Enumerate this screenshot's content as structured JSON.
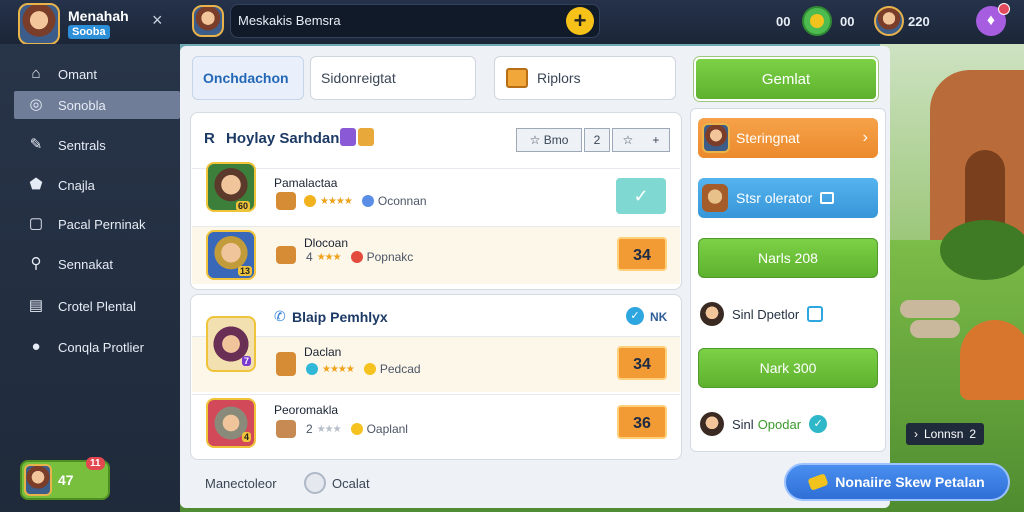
{
  "header": {
    "app_title": "Menahah",
    "app_badge": "Sooba",
    "close_glyph": "×",
    "search_text": "Meskakis Bemsra",
    "plus_glyph": "+",
    "stat_left": "00",
    "stat_mid": "00",
    "stat_right": "220"
  },
  "sidebar": {
    "items": [
      {
        "label": "Omant",
        "icon": "home-icon",
        "glyph": "⌂"
      },
      {
        "label": "Sonobla",
        "icon": "camera-icon",
        "glyph": "◎"
      },
      {
        "label": "Sentrals",
        "icon": "leaf-icon",
        "glyph": "✎"
      },
      {
        "label": "Cnajla",
        "icon": "house-icon",
        "glyph": "⬟"
      },
      {
        "label": "Pacal Perninak",
        "icon": "page-icon",
        "glyph": "▢"
      },
      {
        "label": "Sennakat",
        "icon": "search-icon",
        "glyph": "⚲"
      },
      {
        "label": "Crotel Plental",
        "icon": "doc-icon",
        "glyph": "▤"
      },
      {
        "label": "Conqla Protlier",
        "icon": "location-pin-icon",
        "glyph": "●"
      }
    ],
    "level_value": "47",
    "level_badge": "11"
  },
  "tabs": {
    "tab1": "Onchdachon",
    "tab2": "Sidonreigtat",
    "tab3": "Riplors",
    "action": "Gemlat"
  },
  "card1": {
    "prefix": "R",
    "title": "Hoylay Sarhdan",
    "tool_label": "Bmo",
    "tool_num": "2",
    "rows": [
      {
        "name": "Pamalactaa",
        "stars": "★★★★",
        "meta": "Oconnan",
        "tag": "60"
      },
      {
        "name": "Dlocoan",
        "stars": "★★★",
        "rank": "4",
        "meta": "Popnakc",
        "value": "34",
        "tag": "13"
      }
    ]
  },
  "card2": {
    "title": "Blaip Pemhlyx",
    "right_label": "NK",
    "rows": [
      {
        "name": "Daclan",
        "stars": "★★★★",
        "meta": "Pedcad",
        "value": "34",
        "tag": "7"
      },
      {
        "name": "Peoromakla",
        "stars": "★★★",
        "rank": "2",
        "meta": "Oaplanl",
        "value": "36",
        "tag": "4"
      }
    ]
  },
  "right": {
    "btn1": "Steringnat",
    "btn1_chevron": "›",
    "btn2": "Stsr olerator",
    "btn3": "Narls 208",
    "player1": "Sinl Dpetlor",
    "btn4": "Nark 300",
    "player2_a": "Sinl",
    "player2_b": "Opodar"
  },
  "footer": {
    "left": "Manectoleor",
    "right": "Ocalat",
    "cta": "Nonaiire Skew Petalan",
    "legend": "Lonnsn",
    "legend_num": "2"
  },
  "colors": {
    "accent_blue": "#2f6fd6",
    "accent_green": "#5db12d",
    "accent_orange": "#ec8a2c",
    "sidebar_bg": "#283448"
  }
}
